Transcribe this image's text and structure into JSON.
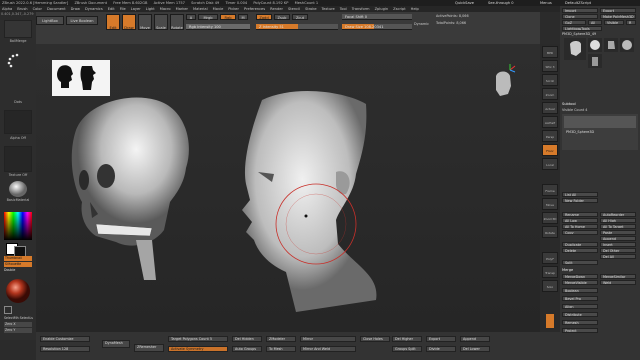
{
  "titlebar": {
    "items": [
      "ZBrush 2022.0.6 [Hemming Sandler]",
      "ZBrush Document",
      "Free Mem 8.602GB",
      "Active Mem 1757",
      "Scratch Disk 49",
      "Timer 0.004",
      "PolyCount 8.192 KP",
      "MeshCount 1"
    ],
    "quicksave": "QuickSave",
    "seethrough": "See-through 0",
    "menus": "Menus",
    "script": "DefaultZScript"
  },
  "menubar": {
    "items": [
      "Alpha",
      "Brush",
      "Color",
      "Document",
      "Draw",
      "Dynamics",
      "Edit",
      "File",
      "Layer",
      "Light",
      "Macro",
      "Marker",
      "Material",
      "Movie",
      "Picker",
      "Preferences",
      "Render",
      "Stencil",
      "Stroke",
      "Texture",
      "Tool",
      "Transform",
      "Zplugin",
      "Zscript",
      "Help"
    ]
  },
  "coords": "0.401,0.347,-0.279",
  "left": {
    "brush_label": "BallMerge",
    "dots_label": "Dots",
    "alpha_label": "Alpha Off",
    "texture_label": "Texture Off",
    "material_label": "BasicMaterial",
    "gradient_label": "Gradient",
    "switchcolor_label": "SwitchColor",
    "alternate_label": "Alternate",
    "thumbnail_label": "Thumbnail",
    "silhouette_label": "Silhouette",
    "double_label": "Double",
    "selmask_label": "SelectMh SelectLs",
    "zero1": "Zero X",
    "zero2": "Zero Y"
  },
  "toolbar": {
    "lightbox": "LightBox",
    "livebool": "Live Boolean",
    "edit": "Edit",
    "draw": "Draw",
    "move": "Move",
    "scale": "Scale",
    "rotate": "Rotate",
    "mrgb": "Mrgb",
    "rgb": "Rgb",
    "m": "M",
    "zadd": "Zadd",
    "zsub": "Zsub",
    "zcut": "Zcut",
    "rgb_intensity": "Rgb Intensity 100",
    "z_intensity": "Z Intensity 51",
    "focal_shift": "Focal Shift 0",
    "draw_size": "Draw Size 108.20341",
    "dynamic": "Dynamic",
    "active_points": "ActivePoints: 8,066",
    "total_points": "TotalPoints: 8,066"
  },
  "rightpanel": {
    "import": "Import",
    "export": "Export",
    "clone": "Clone",
    "make_polymesh": "Make PolyMesh3D",
    "goz": "GoZ",
    "all": "All",
    "visible": "Visible",
    "r": "R",
    "lightbox_tools": "Lightbox▸Tools",
    "tool_name": "PM3D_Sphere3D_49",
    "subtool": "Subtool",
    "visible_count": "Visible Count 4",
    "subtool_item": "PM3D_Sphere3D",
    "list_all": "List All",
    "new_folder": "New Folder",
    "rename": "Rename",
    "autoreorder": "AutoReorder",
    "all_low": "All Low",
    "all_high": "All High",
    "copy": "Copy",
    "paste": "Paste",
    "append": "Append",
    "duplicate": "Duplicate",
    "insert": "Insert",
    "delete": "Delete",
    "del_other": "Del Other",
    "del_all": "Del All",
    "split": "Split",
    "merge": "Merge",
    "mergedown": "MergeDown",
    "mergesimilar": "MergeSimilar",
    "mergevisible": "MergeVisible",
    "weld": "Weld",
    "boolean": "Boolean",
    "bevelpro": "Bevel Pro",
    "align": "Align",
    "distribute": "Distribute",
    "remesh": "Remesh",
    "project": "Project",
    "to_target": "All To Target",
    "all_to_home": "All To Home"
  },
  "bottombar": {
    "enable_customize": "Enable Customize",
    "resolution": "Resolution 128",
    "dynamesh": "DynaMesh",
    "zremesher": "ZRemesher",
    "target_poly": "Target Polygons Count 5",
    "activate_symmetry": "Activate Symmetry",
    "del_hidden": "Del Hidden",
    "auto_groups": "Auto Groups",
    "zmodeler": "ZModeler",
    "to_mesh": "To Mesh",
    "mirror": "Mirror",
    "mirror_and_weld": "Mirror And Weld",
    "close_holes": "Close Holes",
    "groups_split": "Groups Split",
    "del_higher": "Del Higher",
    "export": "Export",
    "append": "Append",
    "divide": "Divide",
    "del_lower": "Del Lower"
  },
  "strip": {
    "bpr": "BPR",
    "spix": "SPix 3",
    "scroll": "Scroll",
    "zoom": "Zoom",
    "actual": "Actual",
    "aahalf": "AAHalf",
    "persp": "Persp",
    "floor": "Floor",
    "local": "Local",
    "frame": "Frame",
    "move": "Move",
    "zoom3d": "Zoom3D",
    "rotate": "Rotate",
    "polyf": "PolyF",
    "transp": "Transp",
    "solo": "Solo"
  },
  "colors": {
    "accent": "#d67a2a",
    "panel": "#333333"
  }
}
